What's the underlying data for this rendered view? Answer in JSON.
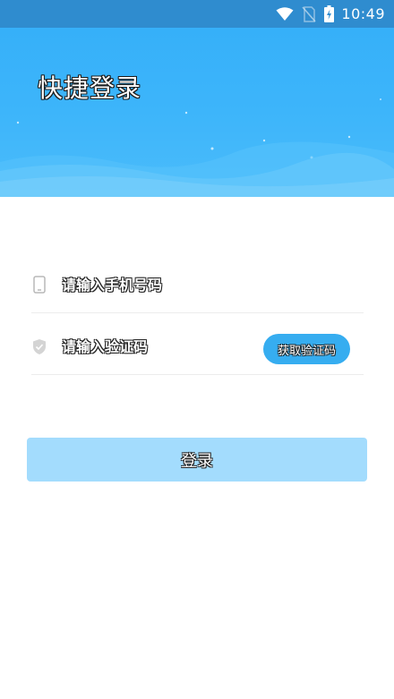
{
  "status_bar": {
    "time": "10:49",
    "icons": [
      "wifi-icon",
      "no-sim-icon",
      "battery-charging-icon"
    ]
  },
  "header": {
    "title": "快捷登录"
  },
  "form": {
    "phone": {
      "placeholder": "请输入手机号码",
      "value": "",
      "icon": "phone-icon"
    },
    "code": {
      "placeholder": "请输入验证码",
      "value": "",
      "icon": "shield-icon"
    },
    "get_code_label": "获取验证码"
  },
  "login_label": "登录",
  "colors": {
    "status_bar": "#2f8ccf",
    "header_blue": "#3db5fa",
    "get_code_button": "#36adf0",
    "login_button": "#a3dcfd"
  }
}
